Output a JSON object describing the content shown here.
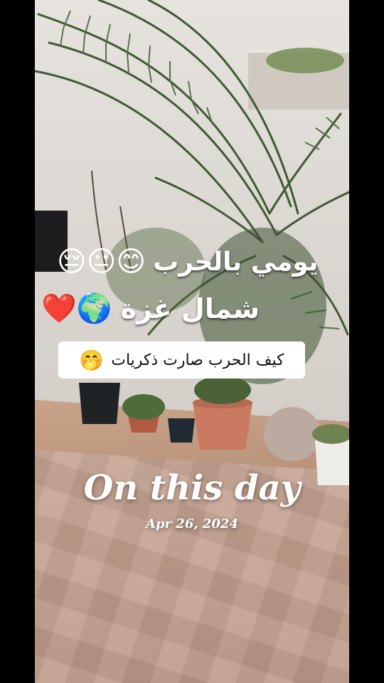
{
  "overlay": {
    "line1_text": "يومي بالحرب",
    "line1_emojis": "😊😐😔",
    "line2_text": "شمال غزة",
    "line2_emojis": "🌍❤️",
    "caption_text": "كيف  الحرب صارت ذكريات",
    "caption_emoji": "🤭"
  },
  "memory": {
    "title": "On this day",
    "date": "Apr 26, 2024"
  }
}
